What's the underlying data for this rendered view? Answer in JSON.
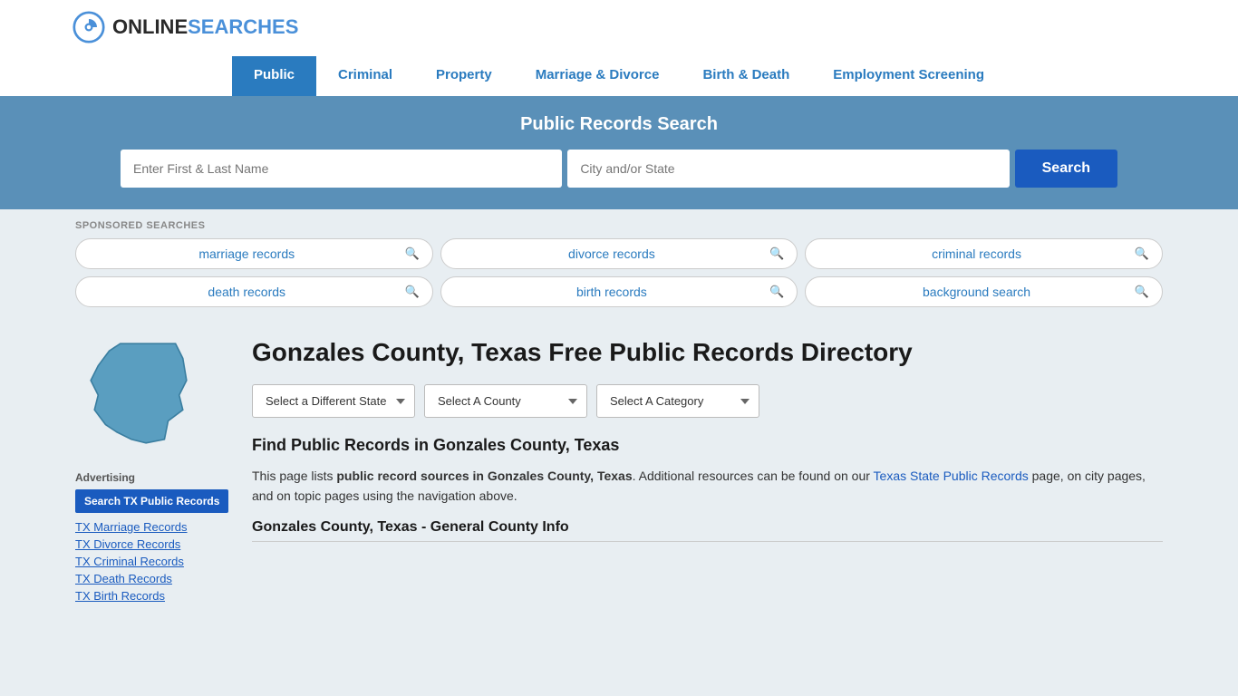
{
  "logo": {
    "online": "ONLINE",
    "searches": "SEARCHES",
    "icon_label": "G"
  },
  "nav": {
    "items": [
      {
        "label": "Public",
        "active": true
      },
      {
        "label": "Criminal",
        "active": false
      },
      {
        "label": "Property",
        "active": false
      },
      {
        "label": "Marriage & Divorce",
        "active": false
      },
      {
        "label": "Birth & Death",
        "active": false
      },
      {
        "label": "Employment Screening",
        "active": false
      }
    ]
  },
  "search_banner": {
    "title": "Public Records Search",
    "name_placeholder": "Enter First & Last Name",
    "location_placeholder": "City and/or State",
    "button_label": "Search"
  },
  "sponsored": {
    "label": "SPONSORED SEARCHES",
    "items": [
      {
        "text": "marriage records"
      },
      {
        "text": "divorce records"
      },
      {
        "text": "criminal records"
      },
      {
        "text": "death records"
      },
      {
        "text": "birth records"
      },
      {
        "text": "background search"
      }
    ]
  },
  "page_title": "Gonzales County, Texas Free Public Records Directory",
  "dropdowns": {
    "state": {
      "label": "Select a Different State"
    },
    "county": {
      "label": "Select A County"
    },
    "category": {
      "label": "Select A Category"
    }
  },
  "find_records": {
    "title": "Find Public Records in Gonzales County, Texas",
    "description_part1": "This page lists ",
    "description_bold": "public record sources in Gonzales County, Texas",
    "description_part2": ". Additional resources can be found on our ",
    "link_text": "Texas State Public Records",
    "description_part3": " page, on city pages, and on topic pages using the navigation above."
  },
  "county_info": {
    "title": "Gonzales County, Texas - General County Info"
  },
  "sidebar": {
    "advertising_label": "Advertising",
    "ad_button": "Search TX Public Records",
    "links": [
      {
        "text": "TX Marriage Records"
      },
      {
        "text": "TX Divorce Records"
      },
      {
        "text": "TX Criminal Records"
      },
      {
        "text": "TX Death Records"
      },
      {
        "text": "TX Birth Records"
      }
    ]
  }
}
